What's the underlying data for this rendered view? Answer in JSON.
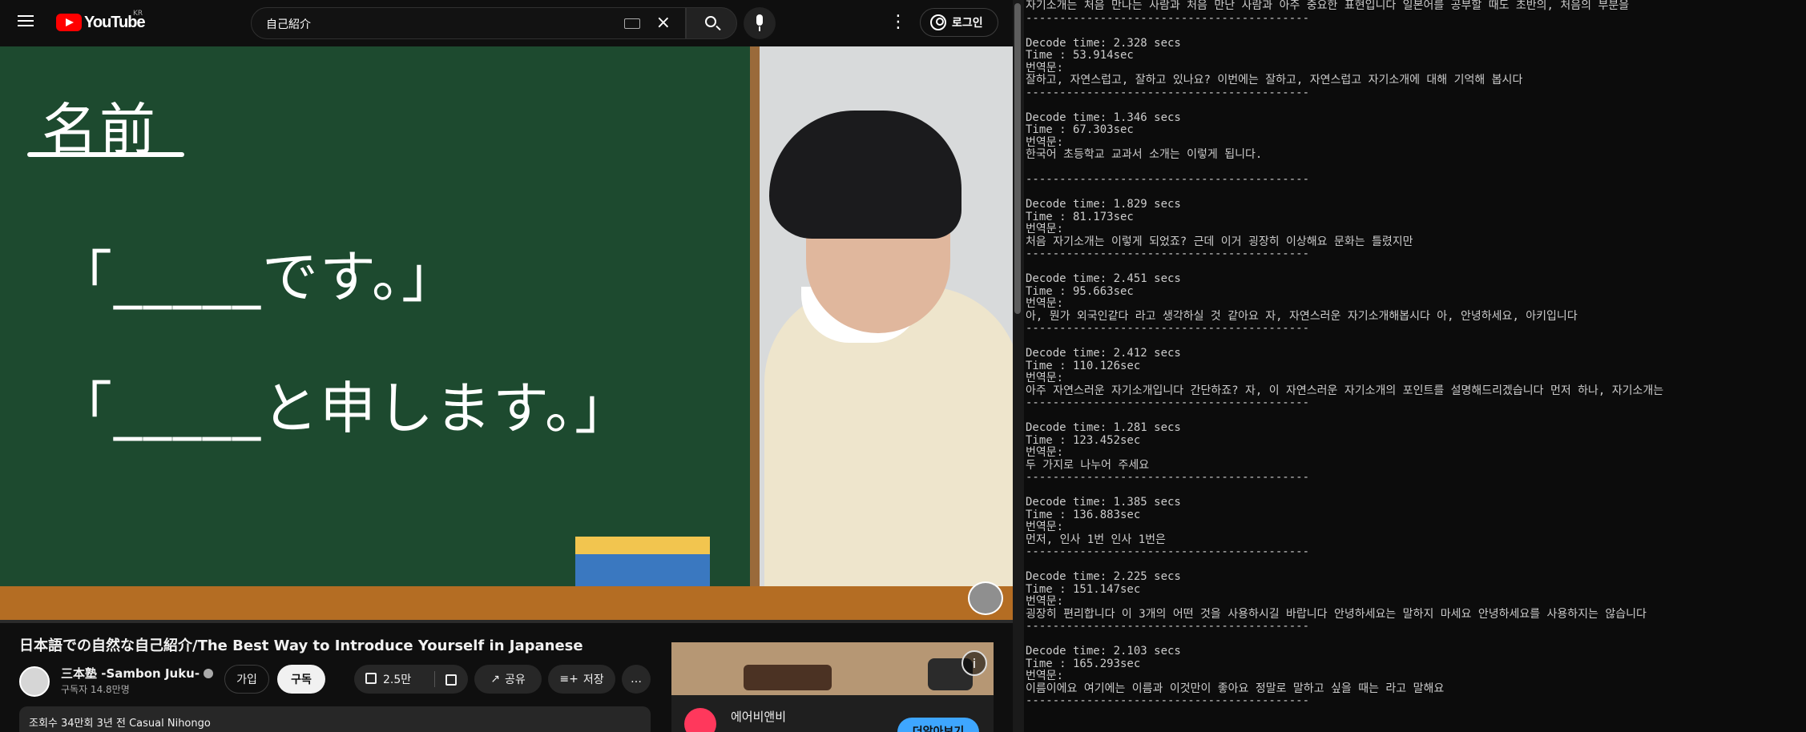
{
  "youtube": {
    "logo_text": "YouTube",
    "country_code": "KR",
    "search_value": "自己紹介",
    "signin_label": "로그인",
    "more_label": "⋮",
    "video": {
      "board_title": "名前",
      "board_line_1": "「_____です。」",
      "board_line_2": "「_____と申します。」"
    },
    "title": "日本語での自然な自己紹介/The Best Way to Introduce Yourself in Japanese",
    "channel": {
      "name": "三本塾 -Sambon Juku-",
      "subscribers": "구독자 14.8만명"
    },
    "join_label": "가입",
    "subscribe_label": "구독",
    "like_count": "2.5만",
    "share_label": "공유",
    "save_label": "저장",
    "more_actions": "…",
    "description": {
      "views": "조회수 34만회",
      "date": "3년 전",
      "tag": "Casual Nihongo"
    },
    "ad": {
      "advertiser": "에어비앤비",
      "cta": "더알아보기",
      "info": "i"
    }
  },
  "terminal": {
    "lines": [
      "자기소개는 처음 만나는 사람과 처음 만난 사람과 아주 중요한 표현입니다 일본어를 공부할 때도 초반의, 처음의 부분을",
      "------------------------------------------",
      "",
      "Decode time: 2.328 secs",
      "Time : 53.914sec",
      "번역문:",
      "잘하고, 자연스럽고, 잘하고 있나요? 이번에는 잘하고, 자연스럽고 자기소개에 대해 기억해 봅시다",
      "------------------------------------------",
      "",
      "Decode time: 1.346 secs",
      "Time : 67.303sec",
      "번역문:",
      "한국어 초등학교 교과서 소개는 이렇게 됩니다.",
      "",
      "------------------------------------------",
      "",
      "Decode time: 1.829 secs",
      "Time : 81.173sec",
      "번역문:",
      "처음 자기소개는 이렇게 되었죠? 근데 이거 굉장히 이상해요 문화는 틀렸지만",
      "------------------------------------------",
      "",
      "Decode time: 2.451 secs",
      "Time : 95.663sec",
      "번역문:",
      "아, 뭔가 외국인같다 라고 생각하실 것 같아요 자, 자연스러운 자기소개해봅시다 아, 안녕하세요, 아키입니다",
      "------------------------------------------",
      "",
      "Decode time: 2.412 secs",
      "Time : 110.126sec",
      "번역문:",
      "아주 자연스러운 자기소개입니다 간단하죠? 자, 이 자연스러운 자기소개의 포인트를 설명해드리겠습니다 먼저 하나, 자기소개는",
      "------------------------------------------",
      "",
      "Decode time: 1.281 secs",
      "Time : 123.452sec",
      "번역문:",
      "두 가지로 나누어 주세요",
      "------------------------------------------",
      "",
      "Decode time: 1.385 secs",
      "Time : 136.883sec",
      "번역문:",
      "먼저, 인사 1번 인사 1번은",
      "------------------------------------------",
      "",
      "Decode time: 2.225 secs",
      "Time : 151.147sec",
      "번역문:",
      "굉장히 편리합니다 이 3개의 어떤 것을 사용하시길 바랍니다 안녕하세요는 말하지 마세요 안녕하세요를 사용하지는 않습니다",
      "------------------------------------------",
      "",
      "Decode time: 2.103 secs",
      "Time : 165.293sec",
      "번역문:",
      "이름이에요 여기에는 이름과 이것만이 좋아요 정말로 말하고 싶을 때는 라고 말해요",
      "------------------------------------------"
    ]
  }
}
